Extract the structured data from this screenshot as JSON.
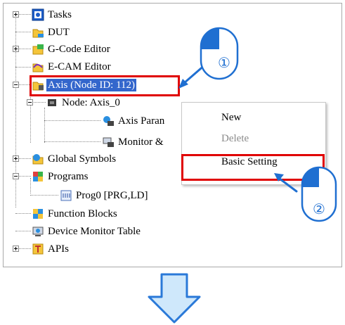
{
  "tree": {
    "items": [
      {
        "label": "Tasks",
        "icon": "tasks-icon"
      },
      {
        "label": "DUT",
        "icon": "dut-icon"
      },
      {
        "label": "G-Code Editor",
        "icon": "gcode-editor-icon"
      },
      {
        "label": "E-CAM Editor",
        "icon": "ecam-editor-icon"
      },
      {
        "label": "Axis (Node ID: 112)",
        "icon": "axis-folder-icon"
      },
      {
        "label": "Node: Axis_0",
        "icon": "node-icon"
      },
      {
        "label": "Axis Paran",
        "icon": "axis-parameter-icon"
      },
      {
        "label": "Monitor &",
        "icon": "monitor-icon"
      },
      {
        "label": "Global Symbols",
        "icon": "global-symbols-icon"
      },
      {
        "label": "Programs",
        "icon": "programs-icon"
      },
      {
        "label": "Prog0 [PRG,LD]",
        "icon": "program-icon"
      },
      {
        "label": "Function Blocks",
        "icon": "function-blocks-icon"
      },
      {
        "label": "Device Monitor Table",
        "icon": "device-monitor-icon"
      },
      {
        "label": "APIs",
        "icon": "apis-icon"
      }
    ]
  },
  "context_menu": {
    "new_label": "New",
    "delete_label": "Delete",
    "basic_setting_label": "Basic Setting"
  },
  "callouts": {
    "step1": "①",
    "step2": "②"
  },
  "colors": {
    "highlight_red": "#e00000",
    "selection_blue": "#3366cc",
    "callout_blue": "#1f6fd1",
    "arrow_fill": "#cfe8fb"
  }
}
